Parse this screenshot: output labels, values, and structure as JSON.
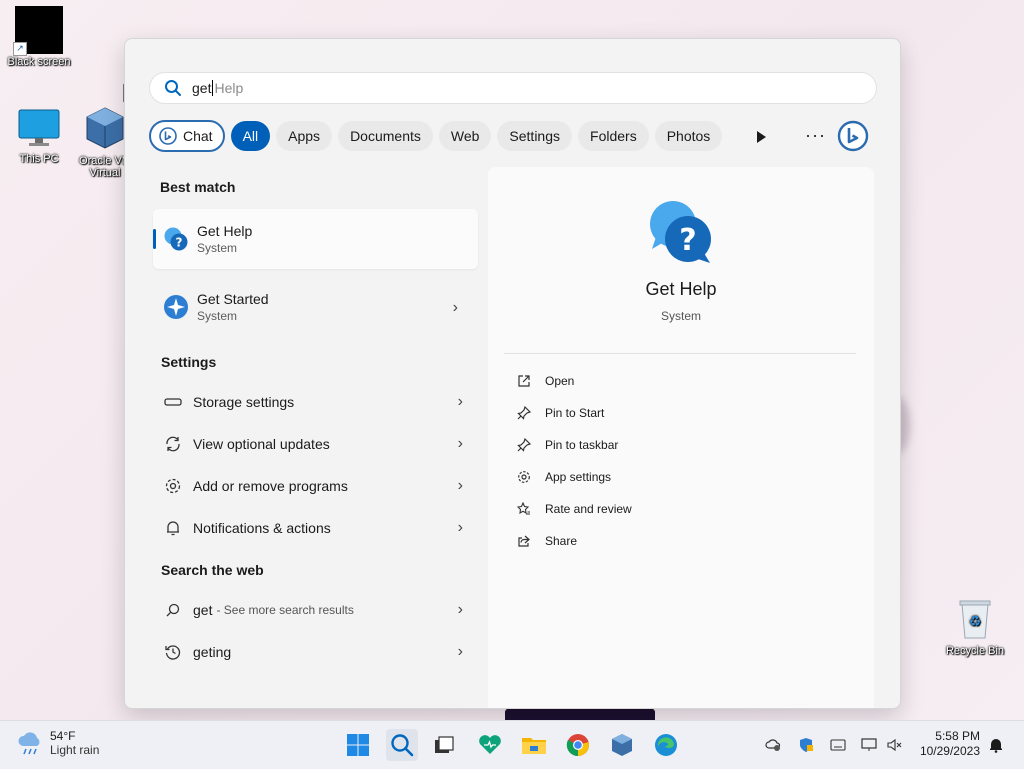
{
  "desktop": {
    "icons": [
      {
        "label": "Black screen"
      },
      {
        "label": "This PC"
      },
      {
        "label": "Oracle VM Virtual"
      },
      {
        "label": "Recycle Bin"
      }
    ]
  },
  "search": {
    "typed": "get",
    "suggestion": "Help"
  },
  "filters": {
    "chat": "Chat",
    "all": "All",
    "apps": "Apps",
    "documents": "Documents",
    "web": "Web",
    "settings": "Settings",
    "folders": "Folders",
    "photos": "Photos",
    "more": "···"
  },
  "results": {
    "best_match_title": "Best match",
    "best_match": {
      "title": "Get Help",
      "sub": "System"
    },
    "second": {
      "title": "Get Started",
      "sub": "System"
    },
    "settings_title": "Settings",
    "settings": [
      {
        "label": "Storage settings"
      },
      {
        "label": "View optional updates"
      },
      {
        "label": "Add or remove programs"
      },
      {
        "label": "Notifications & actions"
      }
    ],
    "web_title": "Search the web",
    "web": [
      {
        "label": "get",
        "muted": "- See more search results"
      },
      {
        "label": "geting",
        "muted": ""
      }
    ],
    "chevron": "›"
  },
  "preview": {
    "title": "Get Help",
    "sub": "System",
    "actions": [
      {
        "label": "Open"
      },
      {
        "label": "Pin to Start"
      },
      {
        "label": "Pin to taskbar"
      },
      {
        "label": "App settings"
      },
      {
        "label": "Rate and review"
      },
      {
        "label": "Share"
      }
    ]
  },
  "taskbar": {
    "temp": "54°F",
    "condition": "Light rain",
    "time": "5:58 PM",
    "date": "10/29/2023"
  },
  "colors": {
    "accent": "#005fb8",
    "help_blue": "#1a73c9"
  }
}
